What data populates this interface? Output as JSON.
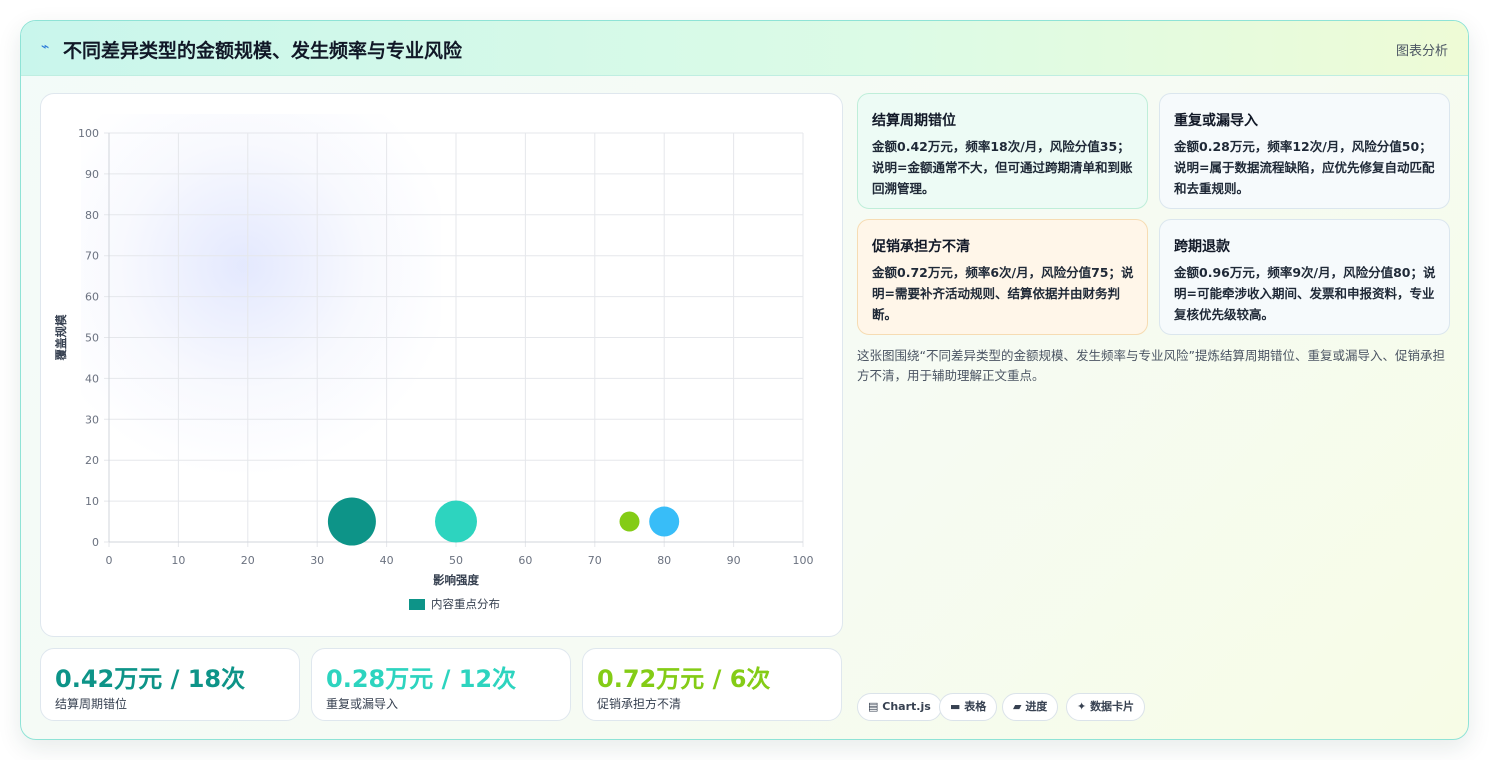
{
  "header": {
    "icon": "lightning-icon",
    "title": "不同差异类型的金额规模、发生频率与专业风险",
    "tag": "图表分析"
  },
  "chart_data": {
    "type": "bubble",
    "xlabel": "影响强度",
    "ylabel": "覆盖规模",
    "xlim": [
      0,
      100
    ],
    "ylim": [
      0,
      100
    ],
    "xticks": [
      0,
      10,
      20,
      30,
      40,
      50,
      60,
      70,
      80,
      90,
      100
    ],
    "yticks": [
      0,
      10,
      20,
      30,
      40,
      50,
      60,
      70,
      80,
      90,
      100
    ],
    "grid": true,
    "legend": {
      "position": "bottom",
      "label": "内容重点分布",
      "color": "#0d9488"
    },
    "points": [
      {
        "x": 35,
        "y": 5,
        "size": 24,
        "color": "#0d9488"
      },
      {
        "x": 50,
        "y": 5,
        "size": 21,
        "color": "#2dd4bf"
      },
      {
        "x": 75,
        "y": 5,
        "size": 10,
        "color": "#84cc16"
      },
      {
        "x": 80,
        "y": 5,
        "size": 15,
        "color": "#38bdf8"
      }
    ]
  },
  "stats": [
    {
      "value": "0.42万元 / 18次",
      "label": "结算周期错位",
      "color": "#0d9488"
    },
    {
      "value": "0.28万元 / 12次",
      "label": "重复或漏导入",
      "color": "#2dd4bf"
    },
    {
      "value": "0.72万元 / 6次",
      "label": "促销承担方不清",
      "color": "#84cc16"
    }
  ],
  "cards": [
    {
      "title": "结算周期错位",
      "body": "金额0.42万元，频率18次/月，风险分值35；说明=金额通常不大，但可通过跨期清单和到账回溯管理。"
    },
    {
      "title": "重复或漏导入",
      "body": "金额0.28万元，频率12次/月，风险分值50；说明=属于数据流程缺陷，应优先修复自动匹配和去重规则。"
    },
    {
      "title": "促销承担方不清",
      "body": "金额0.72万元，频率6次/月，风险分值75；说明=需要补齐活动规则、结算依据并由财务判断。"
    },
    {
      "title": "跨期退款",
      "body": "金额0.96万元，频率9次/月，风险分值80；说明=可能牵涉收入期间、发票和申报资料，专业复核优先级较高。"
    }
  ],
  "summary": "这张图围绕“不同差异类型的金额规模、发生频率与专业风险”提炼结算周期错位、重复或漏导入、促销承担方不清，用于辅助理解正文重点。",
  "chips": [
    {
      "icon": "chart-icon",
      "label": "Chart.js"
    },
    {
      "icon": "table-icon",
      "label": "表格"
    },
    {
      "icon": "progress-icon",
      "label": "进度"
    },
    {
      "icon": "sparkle-icon",
      "label": "数据卡片"
    }
  ]
}
